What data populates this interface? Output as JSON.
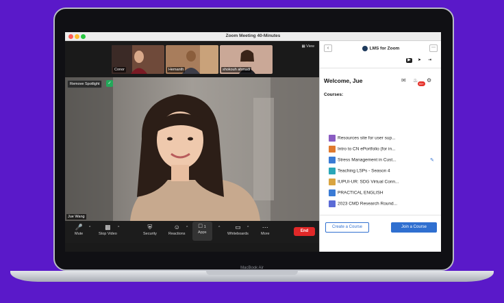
{
  "window": {
    "title": "Zoom Meeting  40-Minutes"
  },
  "video": {
    "view_label": "View",
    "thumbnails": [
      {
        "name": "Conor"
      },
      {
        "name": "Hemanth"
      },
      {
        "name": "shokouh ahmadi"
      }
    ],
    "remove_spotlight": "Remove Spotlight",
    "main_speaker": "Jue Wang"
  },
  "toolbar": {
    "mute": "Mute",
    "stop_video": "Stop Video",
    "security": "Security",
    "reactions": "Reactions",
    "apps": "Apps",
    "apps_count": "1",
    "whiteboards": "Whiteboards",
    "more": "More",
    "end": "End"
  },
  "lms": {
    "title": "LMS for Zoom",
    "welcome": "Welcome, Jue",
    "notification_count": "99+",
    "courses_label": "Courses:",
    "courses": [
      {
        "name": "Resources site for user sup...",
        "color": "#8a5cc2"
      },
      {
        "name": "Intro to CN ePortfolio (for in...",
        "color": "#e07a2e"
      },
      {
        "name": "Stress Management in Cust...",
        "color": "#3a7bd5"
      },
      {
        "name": "Teaching LSPs - Season 4",
        "color": "#2aa6b8"
      },
      {
        "name": "IUPUI-UR: SDG Virtual Conn...",
        "color": "#d9a441"
      },
      {
        "name": "PRACTICAL ENGLISH",
        "color": "#3a7bd5"
      },
      {
        "name": "2023 CMD Research Round...",
        "color": "#5b6bd6"
      }
    ],
    "create_button": "Create a Course",
    "join_button": "Join a Course"
  },
  "laptop": {
    "brand": "MacBook Air"
  },
  "colors": {
    "background": "#5a19c9",
    "accent": "#2f6fd0",
    "end": "#e02828"
  }
}
